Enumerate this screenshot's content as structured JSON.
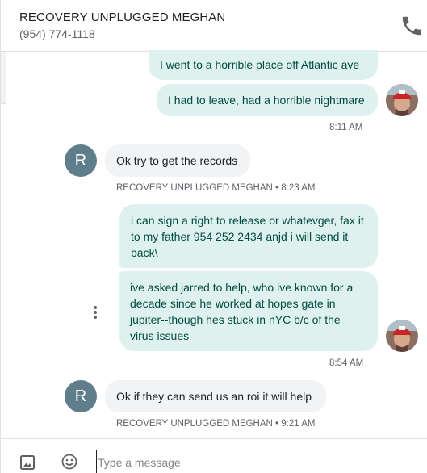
{
  "header": {
    "contact_name": "RECOVERY UNPLUGGED MEGHAN",
    "contact_phone": "(954) 774-1118",
    "call_icon": "phone-icon"
  },
  "messages": [
    {
      "direction": "out",
      "text": "I went to a horrible place off Atlantic ave"
    },
    {
      "direction": "out",
      "text": "I had to leave, had a horrible nightmare"
    },
    {
      "direction": "out",
      "time": "8:11 AM"
    },
    {
      "direction": "in",
      "avatar_letter": "R",
      "text": "Ok try to get the records",
      "meta": "RECOVERY UNPLUGGED MEGHAN • 8:23 AM"
    },
    {
      "direction": "out",
      "text": "i can sign a right to release or whatevger, fax it to my father 954 252 2434 anjd i will send it back\\"
    },
    {
      "direction": "out",
      "text": "ive asked jarred to help, who ive known for a decade since he worked at hopes gate in jupiter--though hes stuck in nYC b/c of the virus issues",
      "time": "8:54 AM"
    },
    {
      "direction": "in",
      "avatar_letter": "R",
      "text": "Ok if they can send us an roi it will help",
      "meta": "RECOVERY UNPLUGGED MEGHAN • 9:21 AM"
    }
  ],
  "compose": {
    "placeholder": "Type a message",
    "value": "",
    "attach_icon": "image-icon",
    "emoji_icon": "emoji-icon"
  },
  "colors": {
    "outgoing_bubble": "#dff1ee",
    "outgoing_text": "#004d40",
    "incoming_bubble": "#f1f3f4",
    "avatar_letter_bg": "#607d8b"
  }
}
